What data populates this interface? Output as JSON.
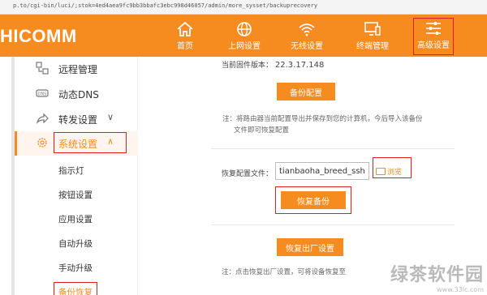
{
  "browser": {
    "url": "p.to/cgi-bin/luci/;stok=4ed4aea9fc9bb3bbafc3ebc998d46057/admin/more_sysset/backuprecovery"
  },
  "header": {
    "logo": "HICOMM",
    "nav": [
      {
        "label": "首页",
        "icon": "home-icon"
      },
      {
        "label": "上网设置",
        "icon": "globe-icon"
      },
      {
        "label": "无线设置",
        "icon": "wifi-icon"
      },
      {
        "label": "终端管理",
        "icon": "monitor-icon"
      },
      {
        "label": "高级设置",
        "icon": "sliders-icon"
      }
    ]
  },
  "sidebar": {
    "items": [
      {
        "label": "远程管理",
        "icon": "remote-icon"
      },
      {
        "label": "动态DNS",
        "icon": "dns-icon"
      },
      {
        "label": "转发设置",
        "icon": "share-icon",
        "chevron": "∨"
      },
      {
        "label": "系统设置",
        "icon": "gear-icon",
        "chevron": "∧"
      }
    ],
    "sub_items": [
      "指示灯",
      "按钮设置",
      "应用设置",
      "自动升级",
      "手动升级",
      "备份恢复"
    ]
  },
  "main": {
    "firmware_label": "当前固件版本：",
    "firmware_version": "22.3.17.148",
    "backup_button": "备份配置",
    "backup_note_line1": "注：将路由器当前配置导出并保存到您的计算机，今后导入该备份",
    "backup_note_line2": "文件即可恢复配置",
    "restore_label": "恢复配置文件：",
    "restore_file": "tianbaoha_breed_ssh.dat",
    "browse_label": "浏览",
    "restore_button": "恢复备份",
    "factory_button": "恢复出厂设置",
    "factory_note": "注：点击恢复出厂设置，可将设备恢复至"
  },
  "watermark": {
    "title": "绿茶软件园",
    "url": "www.33lc.com"
  },
  "colors": {
    "accent": "#f68b1f",
    "highlight": "#e02020"
  }
}
